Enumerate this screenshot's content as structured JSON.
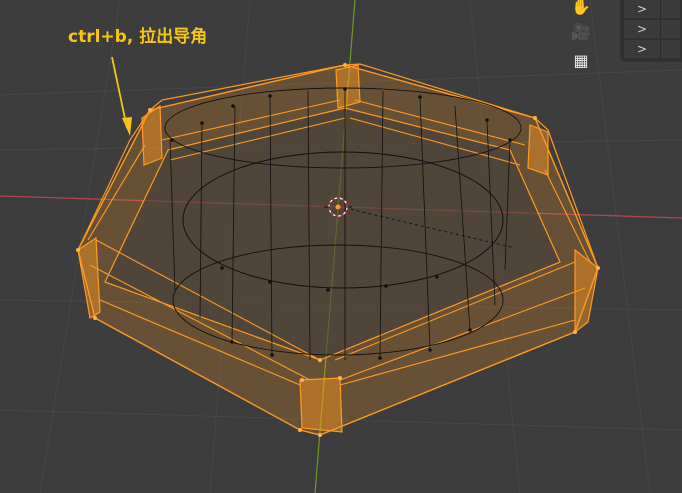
{
  "annotation": {
    "text": "ctrl+b, 拉出导角"
  },
  "colors": {
    "background": "#3d3d3d",
    "grid_line": "#4a4a4a",
    "x_axis": "#b5464f",
    "y_axis": "#6f9a2a",
    "selection_orange": "#ff9a1f",
    "wireframe": "#111111",
    "annotation_text": "#f5c518"
  },
  "nav_gizmos": [
    {
      "name": "hand-icon",
      "glyph": "✋"
    },
    {
      "name": "camera-icon",
      "glyph": "🎥"
    },
    {
      "name": "grid-icon",
      "glyph": "▦"
    }
  ],
  "side_panel": {
    "rows": [
      {
        "chevron": ">"
      },
      {
        "chevron": ">"
      },
      {
        "chevron": ">"
      }
    ]
  }
}
